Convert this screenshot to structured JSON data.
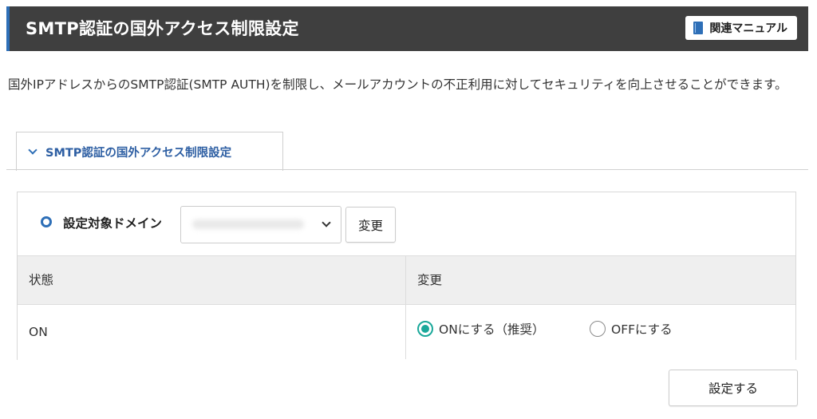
{
  "header": {
    "title": "SMTP認証の国外アクセス制限設定",
    "manual_label": "関連マニュアル"
  },
  "description": "国外IPアドレスからのSMTP認証(SMTP AUTH)を制限し、メールアカウントの不正利用に対してセキュリティを向上させることができます。",
  "tab": {
    "label": "SMTP認証の国外アクセス制限設定"
  },
  "domain_selector": {
    "label": "設定対象ドメイン",
    "selected_value": "",
    "change_button": "変更"
  },
  "table": {
    "headers": [
      "状態",
      "変更"
    ],
    "status_value": "ON",
    "options": [
      {
        "label": "ONにする（推奨）",
        "checked": true
      },
      {
        "label": "OFFにする",
        "checked": false
      }
    ]
  },
  "submit_label": "設定する",
  "colors": {
    "header_bg": "#3f3f3f",
    "accent_blue": "#2e6fb7",
    "radio_checked": "#1aa89a"
  }
}
